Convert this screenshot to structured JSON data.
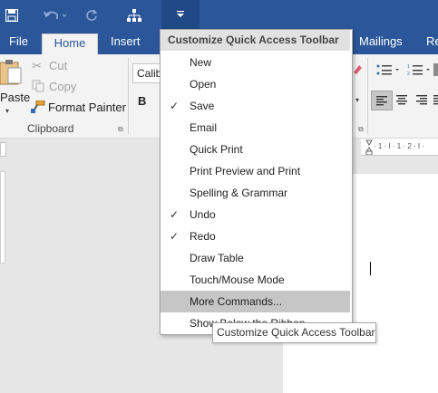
{
  "colors": {
    "brand": "#2b579a",
    "highlight": "#c6c6c6"
  },
  "qat": {
    "icons": [
      "save-icon",
      "undo-icon",
      "redo-icon",
      "sitemap-icon",
      "customize-qat-dropdown-icon"
    ]
  },
  "tabs": [
    "File",
    "Home",
    "Insert",
    "Mailings",
    "Re"
  ],
  "ribbon": {
    "paste": "Paste",
    "cut": "Cut",
    "copy": "Copy",
    "format_painter": "Format Painter",
    "clipboard_group": "Clipboard",
    "font_name": "Calib",
    "bold": "B"
  },
  "menu": {
    "title": "Customize Quick Access Toolbar",
    "items": [
      {
        "label": "New",
        "checked": false
      },
      {
        "label": "Open",
        "checked": false
      },
      {
        "label": "Save",
        "checked": true
      },
      {
        "label": "Email",
        "checked": false
      },
      {
        "label": "Quick Print",
        "checked": false
      },
      {
        "label": "Print Preview and Print",
        "checked": false
      },
      {
        "label": "Spelling & Grammar",
        "checked": false
      },
      {
        "label": "Undo",
        "checked": true
      },
      {
        "label": "Redo",
        "checked": true
      },
      {
        "label": "Draw Table",
        "checked": false
      },
      {
        "label": "Touch/Mouse Mode",
        "checked": false
      },
      {
        "label": "More Commands...",
        "checked": false
      },
      {
        "label": "Show Below the Ribbon",
        "checked": false
      }
    ]
  },
  "tooltip": "Customize Quick Access Toolbar"
}
